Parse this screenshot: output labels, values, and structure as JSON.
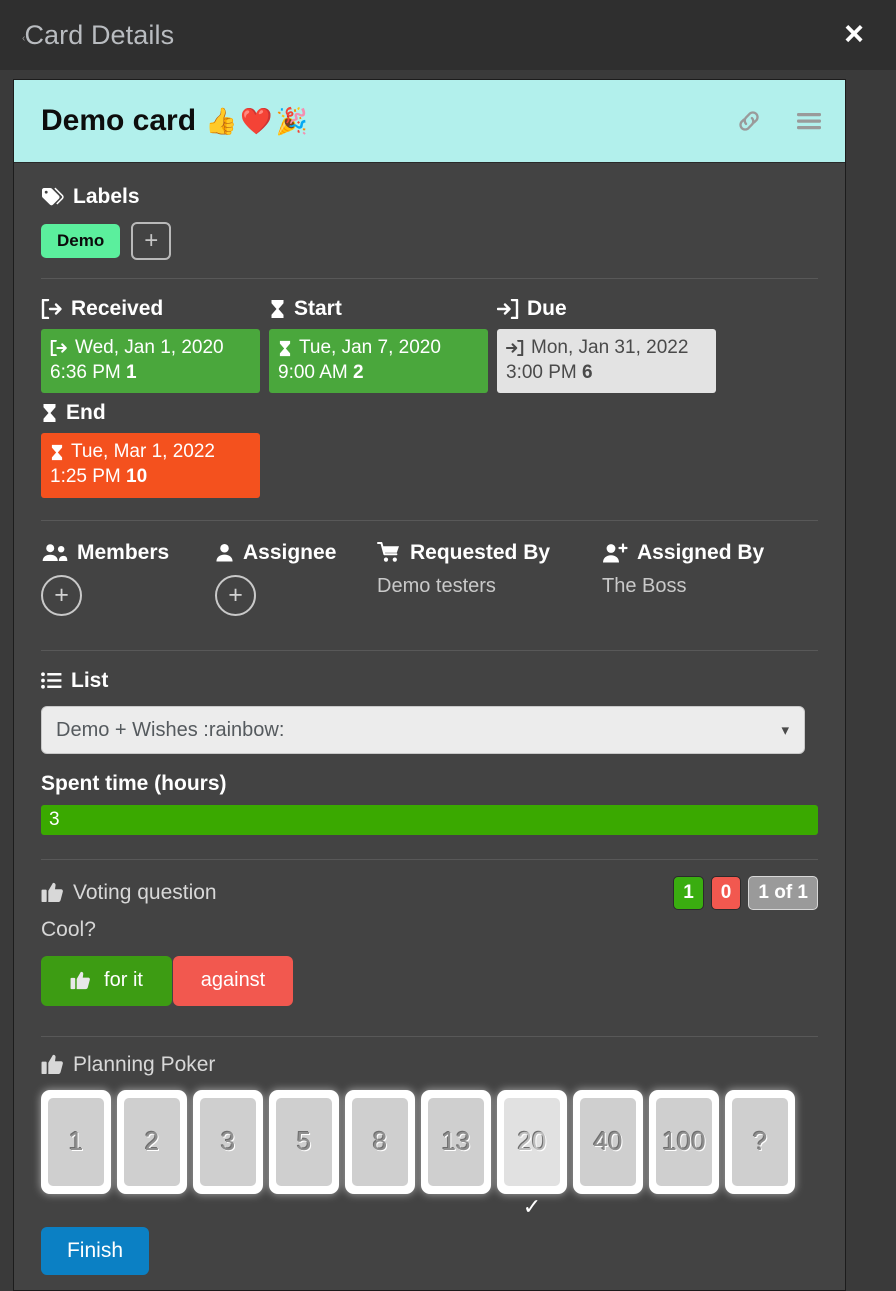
{
  "modal": {
    "title": "Card Details",
    "leading_glyph": "‹",
    "close_label": "×"
  },
  "card": {
    "title": "Demo card",
    "emojis": "👍❤️🎉",
    "header_color": "#b2f0ec",
    "link_icon": "link-icon",
    "menu_icon": "hamburger-menu-icon"
  },
  "labels": {
    "heading": "Labels",
    "icon": "tag-icon",
    "items": [
      {
        "text": "Demo",
        "color": "#5bef9d"
      }
    ],
    "add_label": "+"
  },
  "dates": {
    "items": [
      {
        "heading": "Received",
        "icon": "sign-in-icon",
        "date": "Wed, Jan 1, 2020",
        "time": "6:36 PM",
        "badge": "1",
        "style": "green",
        "color": "#4aa73c"
      },
      {
        "heading": "Start",
        "icon": "hourglass-icon",
        "date": "Tue, Jan 7, 2020",
        "time": "9:00 AM",
        "badge": "2",
        "style": "green",
        "color": "#4aa73c"
      },
      {
        "heading": "Due",
        "icon": "sign-out-icon",
        "date": "Mon, Jan 31, 2022",
        "time": "3:00 PM",
        "badge": "6",
        "style": "grey",
        "color": "#e3e3e3"
      },
      {
        "heading": "End",
        "icon": "hourglass-icon",
        "date": "Tue, Mar 1, 2022",
        "time": "1:25 PM",
        "badge": "10",
        "style": "red",
        "color": "#f4511e"
      }
    ]
  },
  "people": {
    "members": {
      "heading": "Members",
      "icon": "users-icon",
      "add_label": "+"
    },
    "assignee": {
      "heading": "Assignee",
      "icon": "user-icon",
      "add_label": "+"
    },
    "requested_by": {
      "heading": "Requested By",
      "icon": "cart-icon",
      "value": "Demo testers"
    },
    "assigned_by": {
      "heading": "Assigned By",
      "icon": "user-plus-icon",
      "value": "The Boss"
    }
  },
  "list": {
    "heading": "List",
    "icon": "list-icon",
    "selected": "Demo + Wishes :rainbow:"
  },
  "spent_time": {
    "label": "Spent time (hours)",
    "value": "3",
    "color": "#3aa900"
  },
  "voting": {
    "heading": "Voting question",
    "icon": "thumbs-up-icon",
    "badges": {
      "for_count": "1",
      "against_count": "0",
      "summary": "1 of 1"
    },
    "question": "Cool?",
    "for_label": "for it",
    "against_label": "against"
  },
  "poker": {
    "heading": "Planning Poker",
    "icon": "thumbs-up-icon",
    "cards": [
      "1",
      "2",
      "3",
      "5",
      "8",
      "13",
      "20",
      "40",
      "100",
      "?"
    ],
    "selected": "20",
    "check_glyph": "✓",
    "finish_label": "Finish"
  }
}
